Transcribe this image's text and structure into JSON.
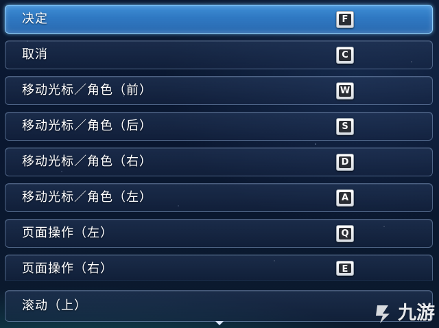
{
  "rows": [
    {
      "label": "决定",
      "key": "F",
      "selected": true
    },
    {
      "label": "取消",
      "key": "C",
      "selected": false
    },
    {
      "label": "移动光标／角色（前）",
      "key": "W",
      "selected": false
    },
    {
      "label": "移动光标／角色（后）",
      "key": "S",
      "selected": false
    },
    {
      "label": "移动光标／角色（右）",
      "key": "D",
      "selected": false
    },
    {
      "label": "移动光标／角色（左）",
      "key": "A",
      "selected": false
    },
    {
      "label": "页面操作（左）",
      "key": "Q",
      "selected": false
    },
    {
      "label": "页面操作（右）",
      "key": "E",
      "selected": false
    },
    {
      "label": "滚动（上）",
      "key": "",
      "selected": false
    }
  ],
  "watermark": {
    "text": "九游",
    "icon": "jiuyou-logo-icon"
  },
  "scroll_indicator": {
    "icon": "scroll-down-arrow-icon"
  },
  "colors": {
    "selected": "#3a86d0",
    "key_cap": "#2a2d33",
    "background": "#0b1a33"
  }
}
